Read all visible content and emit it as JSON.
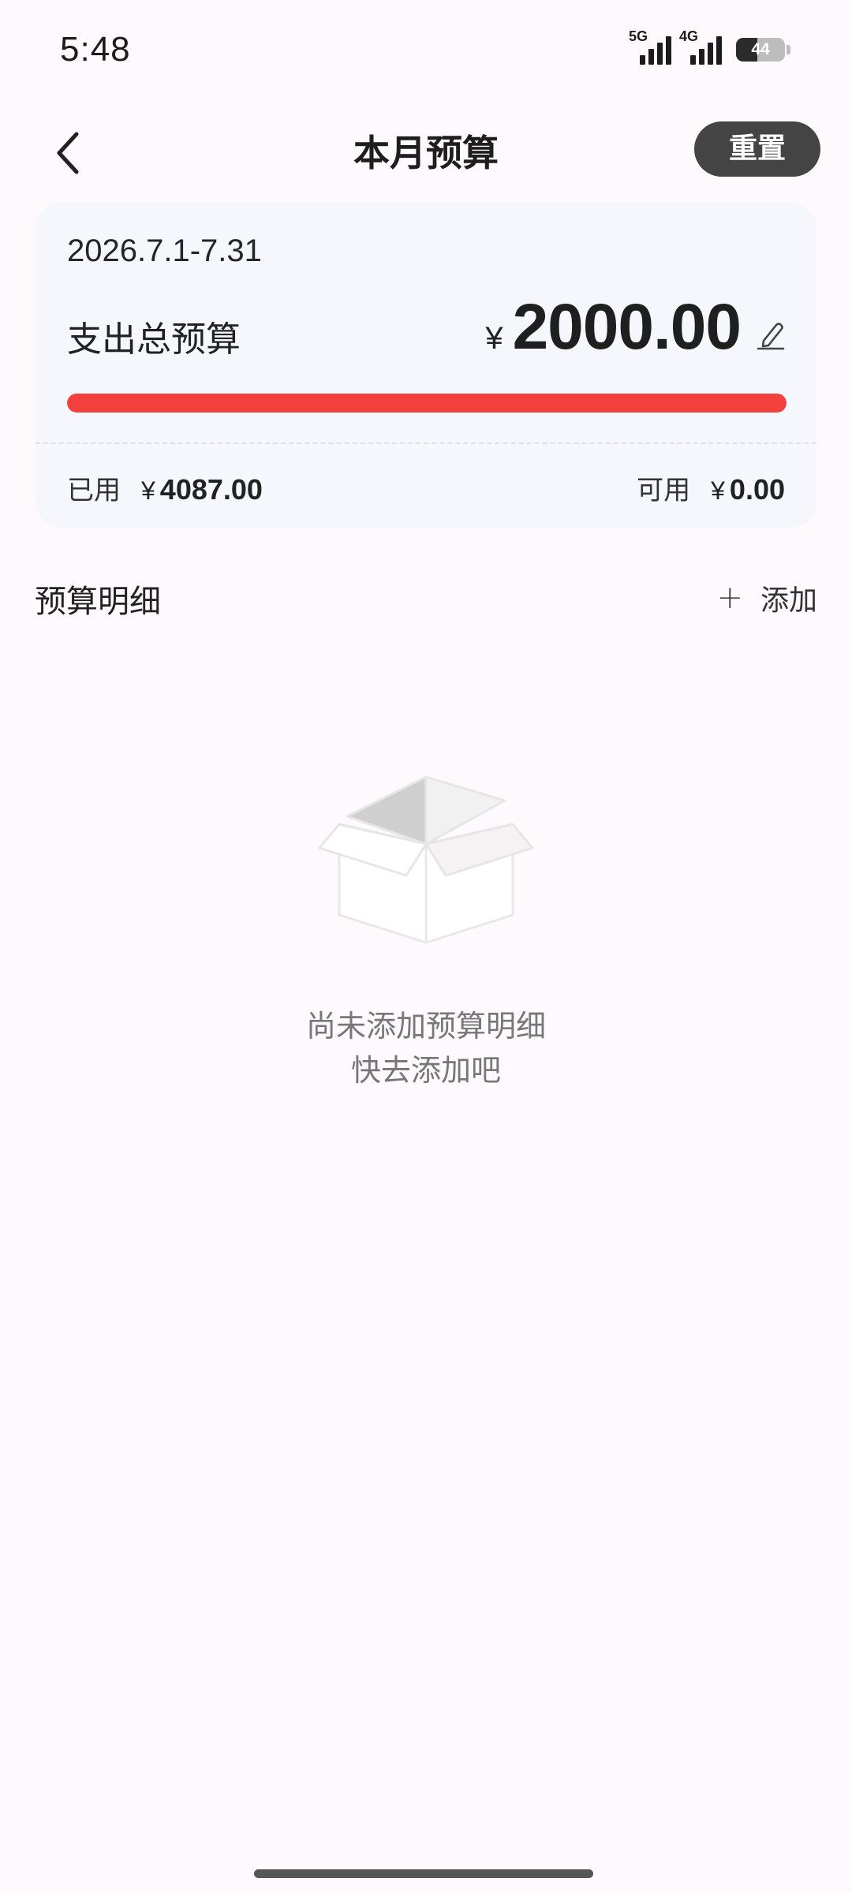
{
  "status_bar": {
    "time": "5:48",
    "network_1": "5G",
    "network_2": "4G",
    "battery": "44",
    "battery_level": 0.44
  },
  "header": {
    "title": "本月预算",
    "reset_label": "重置",
    "back_icon": "chevron-left-icon"
  },
  "budget_card": {
    "date_range": "2026.7.1-7.31",
    "label": "支出总预算",
    "currency": "¥",
    "total": "2000.00",
    "edit_icon": "pencil-icon",
    "progress_fraction": 1.0,
    "progress_color": "#f4403c",
    "used_label": "已用",
    "used_currency": "¥",
    "used_value": "4087.00",
    "available_label": "可用",
    "available_currency": "¥",
    "available_value": "0.00"
  },
  "details": {
    "title": "预算明细",
    "add_label": "添加",
    "add_icon": "plus-icon",
    "empty_icon": "empty-box-icon",
    "empty_line_1": "尚未添加预算明细",
    "empty_line_2": "快去添加吧"
  }
}
